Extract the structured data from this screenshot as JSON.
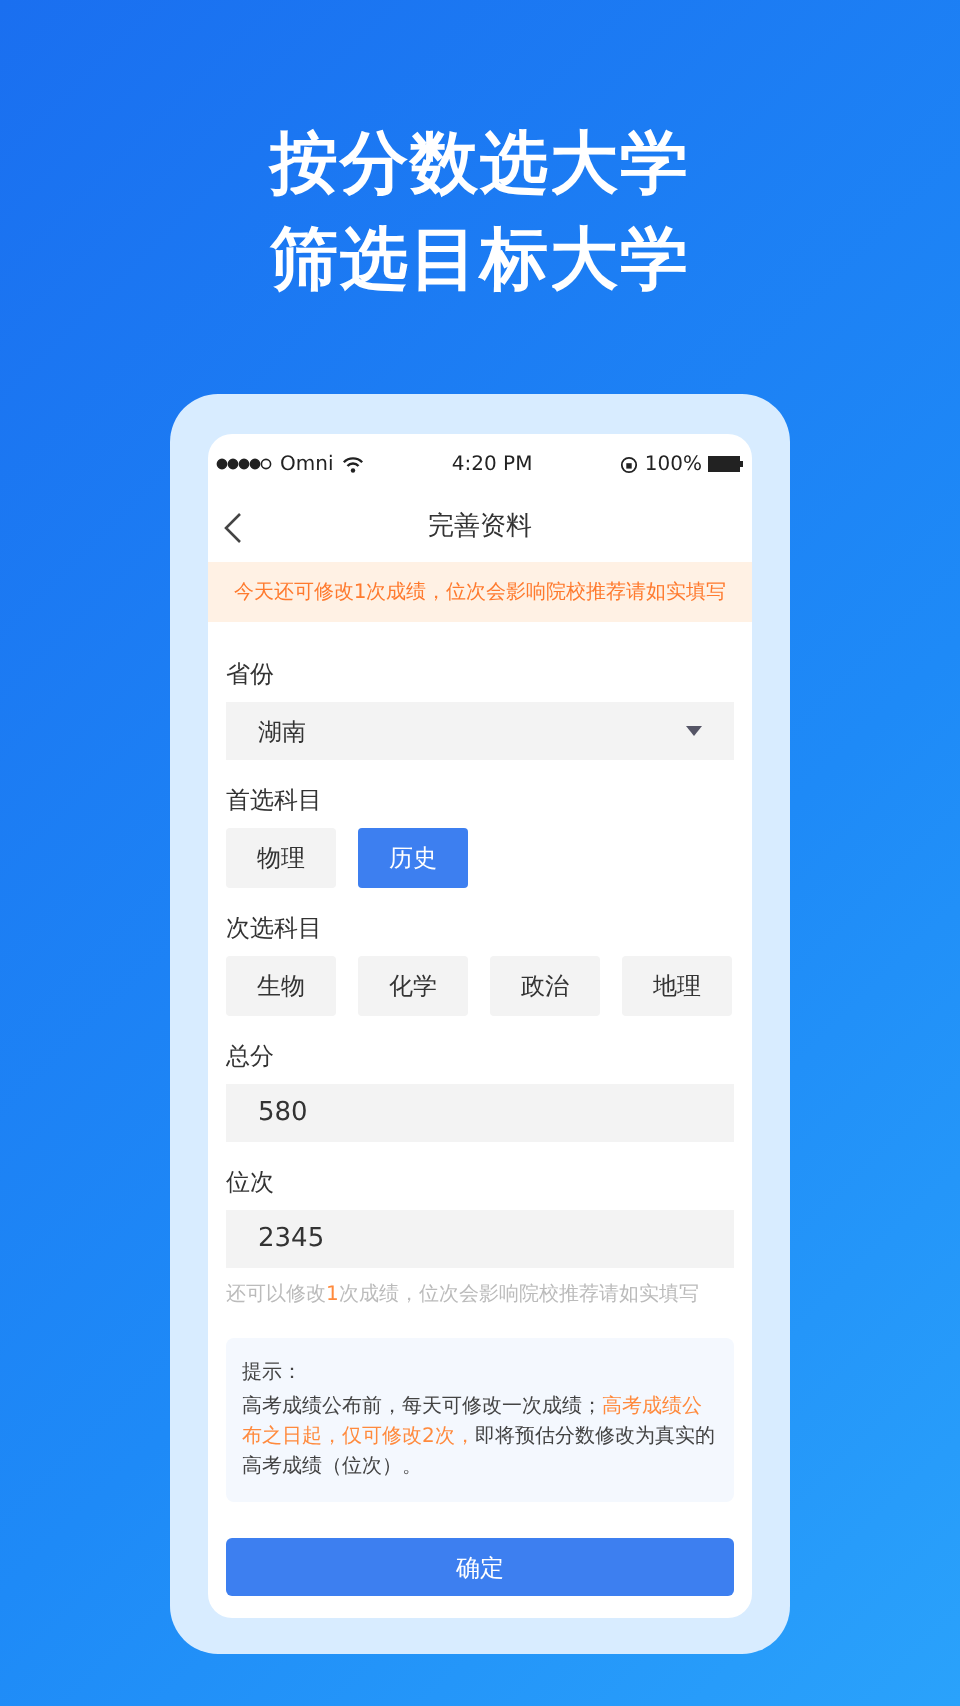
{
  "headline": [
    "按分数选大学",
    "筛选目标大学"
  ],
  "status_bar": {
    "carrier": "Omni",
    "time": "4:20 PM",
    "battery": "100%"
  },
  "nav": {
    "title": "完善资料"
  },
  "notice": "今天还可修改1次成绩，位次会影响院校推荐请如实填写",
  "province": {
    "label": "省份",
    "value": "湖南"
  },
  "first_subject": {
    "label": "首选科目",
    "options": [
      {
        "label": "物理",
        "selected": false
      },
      {
        "label": "历史",
        "selected": true
      }
    ]
  },
  "second_subject": {
    "label": "次选科目",
    "options": [
      {
        "label": "生物",
        "selected": false
      },
      {
        "label": "化学",
        "selected": false
      },
      {
        "label": "政治",
        "selected": false
      },
      {
        "label": "地理",
        "selected": false
      }
    ]
  },
  "score": {
    "label": "总分",
    "value": "580"
  },
  "rank": {
    "label": "位次",
    "value": "2345"
  },
  "remaining_hint": [
    {
      "text": "还可以修改",
      "highlight": false
    },
    {
      "text": "1",
      "highlight": true
    },
    {
      "text": "次成绩，位次会影响院校推荐请如实填写",
      "highlight": false
    }
  ],
  "tips": {
    "title": "提示：",
    "body": [
      {
        "text": "高考成绩公布前，每天可修改一次成绩；",
        "highlight": false
      },
      {
        "text": "高考成绩公布之日起，仅可修改2次，",
        "highlight": true
      },
      {
        "text": "即将预估分数修改为真实的高考成绩（位次）。",
        "highlight": false
      }
    ]
  },
  "confirm_button": "确定"
}
